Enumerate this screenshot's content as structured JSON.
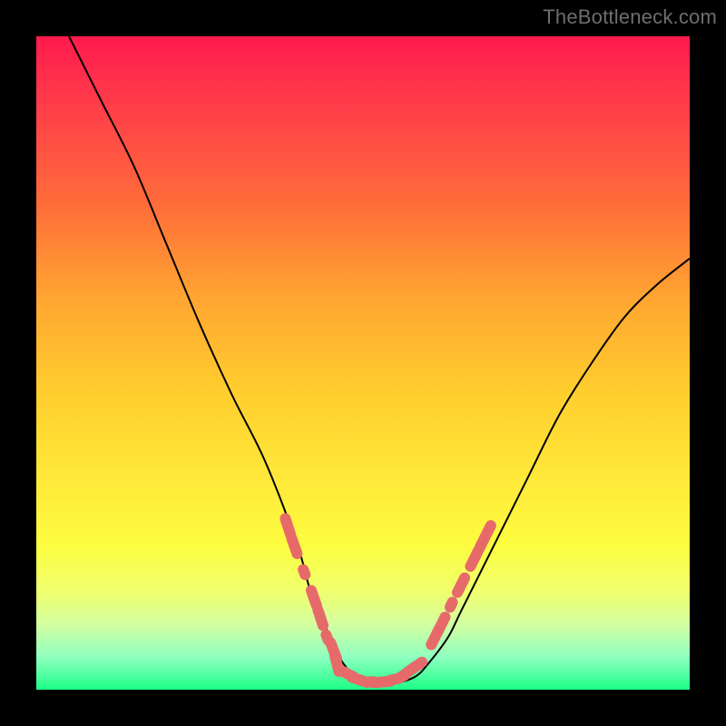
{
  "watermark": "TheBottleneck.com",
  "chart_data": {
    "type": "line",
    "title": "",
    "xlabel": "",
    "ylabel": "",
    "xlim": [
      0,
      100
    ],
    "ylim": [
      0,
      100
    ],
    "grid": false,
    "series": [
      {
        "name": "bottleneck-curve",
        "x": [
          5,
          10,
          15,
          20,
          25,
          30,
          35,
          40,
          42,
          45,
          47,
          50,
          53,
          55,
          58,
          60,
          63,
          65,
          70,
          75,
          80,
          85,
          90,
          95,
          100
        ],
        "y": [
          100,
          90,
          80,
          68,
          56,
          45,
          35,
          22,
          15,
          8,
          4,
          1,
          1,
          1,
          2,
          4,
          8,
          12,
          22,
          32,
          42,
          50,
          57,
          62,
          66
        ]
      },
      {
        "name": "marker-band-left",
        "x": [
          38.5,
          39.5,
          41.0,
          42.5,
          43.5,
          44.5,
          45.5,
          46.0
        ],
        "y": [
          25,
          22,
          18,
          14,
          11,
          8,
          6,
          4
        ]
      },
      {
        "name": "marker-band-bottom",
        "x": [
          47.5,
          49.5,
          51.5,
          53.0,
          54.5,
          56.0,
          57.0,
          58.0
        ],
        "y": [
          2.5,
          1.5,
          1.2,
          1.2,
          1.5,
          2.0,
          2.8,
          3.5
        ]
      },
      {
        "name": "marker-band-right",
        "x": [
          61.0,
          62.0,
          63.5,
          65.0,
          67.0,
          68.0,
          69.0
        ],
        "y": [
          8,
          10,
          13,
          16,
          20,
          22,
          24
        ]
      }
    ],
    "colors": {
      "curve": "#000000",
      "markers": "#e76a6a"
    },
    "background_gradient_meaning": "red=high bottleneck, green=low bottleneck"
  }
}
